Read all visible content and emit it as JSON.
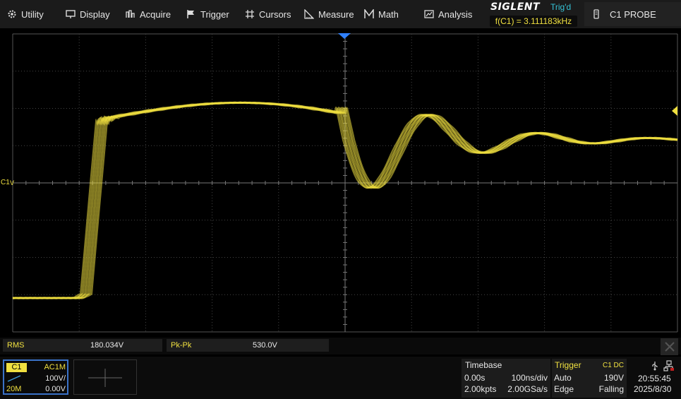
{
  "menu": {
    "utility": "Utility",
    "display": "Display",
    "acquire": "Acquire",
    "trigger": "Trigger",
    "cursors": "Cursors",
    "measure": "Measure",
    "math": "Math",
    "analysis": "Analysis"
  },
  "header": {
    "brand": "SIGLENT",
    "trig_status": "Trig'd",
    "frequency": "f(C1) = 3.111183kHz",
    "probe": "C1 PROBE"
  },
  "waveform": {
    "channel_marker": "C1",
    "color": "#f0e040"
  },
  "measurements": {
    "rms_label": "RMS",
    "rms_value": "180.034V",
    "pkpk_label": "Pk-Pk",
    "pkpk_value": "530.0V"
  },
  "channel": {
    "name": "C1",
    "coupling": "AC1M",
    "scale": "100V/",
    "bandwidth": "20M",
    "offset": "0.00V"
  },
  "timebase": {
    "title": "Timebase",
    "delay": "0.00s",
    "scale": "100ns/div",
    "points": "2.00kpts",
    "rate": "2.00GSa/s"
  },
  "trigger": {
    "title": "Trigger",
    "source": "C1 DC",
    "mode": "Auto",
    "level": "190V",
    "type": "Edge",
    "slope": "Falling"
  },
  "system": {
    "time": "20:55:45",
    "date": "2025/8/30"
  },
  "colors": {
    "channel1": "#f0e040",
    "trig_status": "#35c3d6",
    "marker": "#2f80ff"
  }
}
